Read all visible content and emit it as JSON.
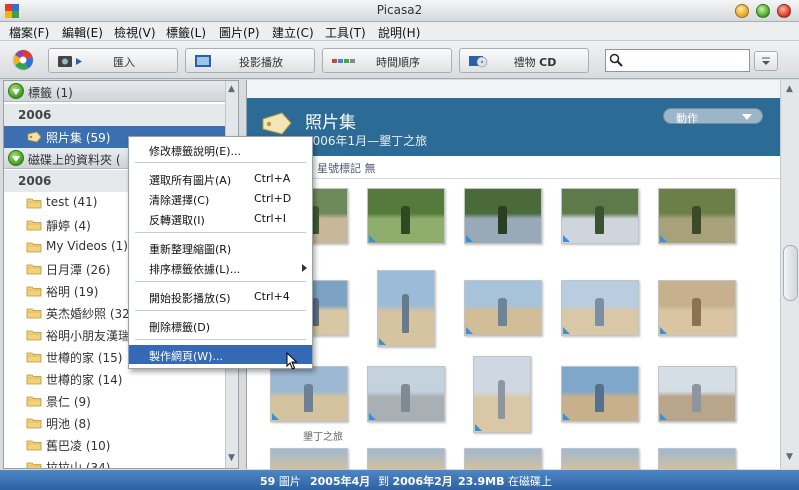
{
  "window": {
    "title": "Picasa2"
  },
  "menubar": [
    {
      "label": "檔案(F)"
    },
    {
      "label": "編輯(E)"
    },
    {
      "label": "檢視(V)"
    },
    {
      "label": "標籤(L)"
    },
    {
      "label": "圖片(P)"
    },
    {
      "label": "建立(C)"
    },
    {
      "label": "工具(T)"
    },
    {
      "label": "說明(H)"
    }
  ],
  "toolbar": {
    "import_label": "匯入",
    "slideshow_label": "投影播放",
    "timeline_label": "時間順序",
    "giftcd_label": "禮物",
    "giftcd_bold": "CD",
    "search": {
      "value": "",
      "placeholder": ""
    }
  },
  "sidebar": {
    "labels_header": "標籤 (1)",
    "labels_year": "2006",
    "label_album": "照片集 (59)",
    "disk_header": "磁碟上的資料夾 (",
    "disk_year": "2006",
    "folders": [
      {
        "label": "test (41)"
      },
      {
        "label": "靜婷 (4)"
      },
      {
        "label": "My Videos (1)"
      },
      {
        "label": "日月潭 (26)"
      },
      {
        "label": "裕明 (19)"
      },
      {
        "label": "英杰婚紗照 (32"
      },
      {
        "label": "裕明小朋友漢瑞"
      },
      {
        "label": "世樽的家 (15)"
      },
      {
        "label": "世樽的家 (14)"
      },
      {
        "label": "景仁 (9)"
      },
      {
        "label": "明池 (8)"
      },
      {
        "label": "舊巴凌 (10)"
      },
      {
        "label": "拉拉山 (34)"
      }
    ]
  },
  "album": {
    "title": "照片集",
    "subtitle": "2006年1月—墾丁之旅",
    "action_label": "動作",
    "rating_text": "星號標記 無",
    "caption": "墾丁之旅"
  },
  "context_menu": {
    "items": [
      {
        "label": "修改標籤說明(E)...",
        "shortcut": ""
      },
      {
        "label": "選取所有圖片(A)",
        "shortcut": "Ctrl+A"
      },
      {
        "label": "清除選擇(C)",
        "shortcut": "Ctrl+D"
      },
      {
        "label": "反轉選取(I)",
        "shortcut": "Ctrl+I"
      },
      {
        "label": "重新整理縮圖(R)",
        "shortcut": ""
      },
      {
        "label": "排序標籤依據(L)...",
        "shortcut": ""
      },
      {
        "label": "開始投影播放(S)",
        "shortcut": "Ctrl+4"
      },
      {
        "label": "刪除標籤(D)",
        "shortcut": ""
      },
      {
        "label": "製作網頁(W)...",
        "shortcut": ""
      }
    ]
  },
  "statusbar": {
    "count_num": "59",
    "count_unit": "圖片",
    "from_text": "2005年4月",
    "to_prefix": "到",
    "to_text": "2006年2月",
    "size_text": "23.9MB",
    "size_suffix": "在磁碟上"
  },
  "colors": {
    "album_header_bg": "#2c6b96",
    "selection": "#3b6fb0",
    "status_bg": "#2c62a3"
  },
  "icons": {
    "app": "picasa-logo-icon",
    "search": "magnifier-icon",
    "folder": "folder-icon",
    "tag": "tag-icon",
    "expand": "green-circle-arrow-icon",
    "cursor": "mouse-pointer-icon"
  }
}
